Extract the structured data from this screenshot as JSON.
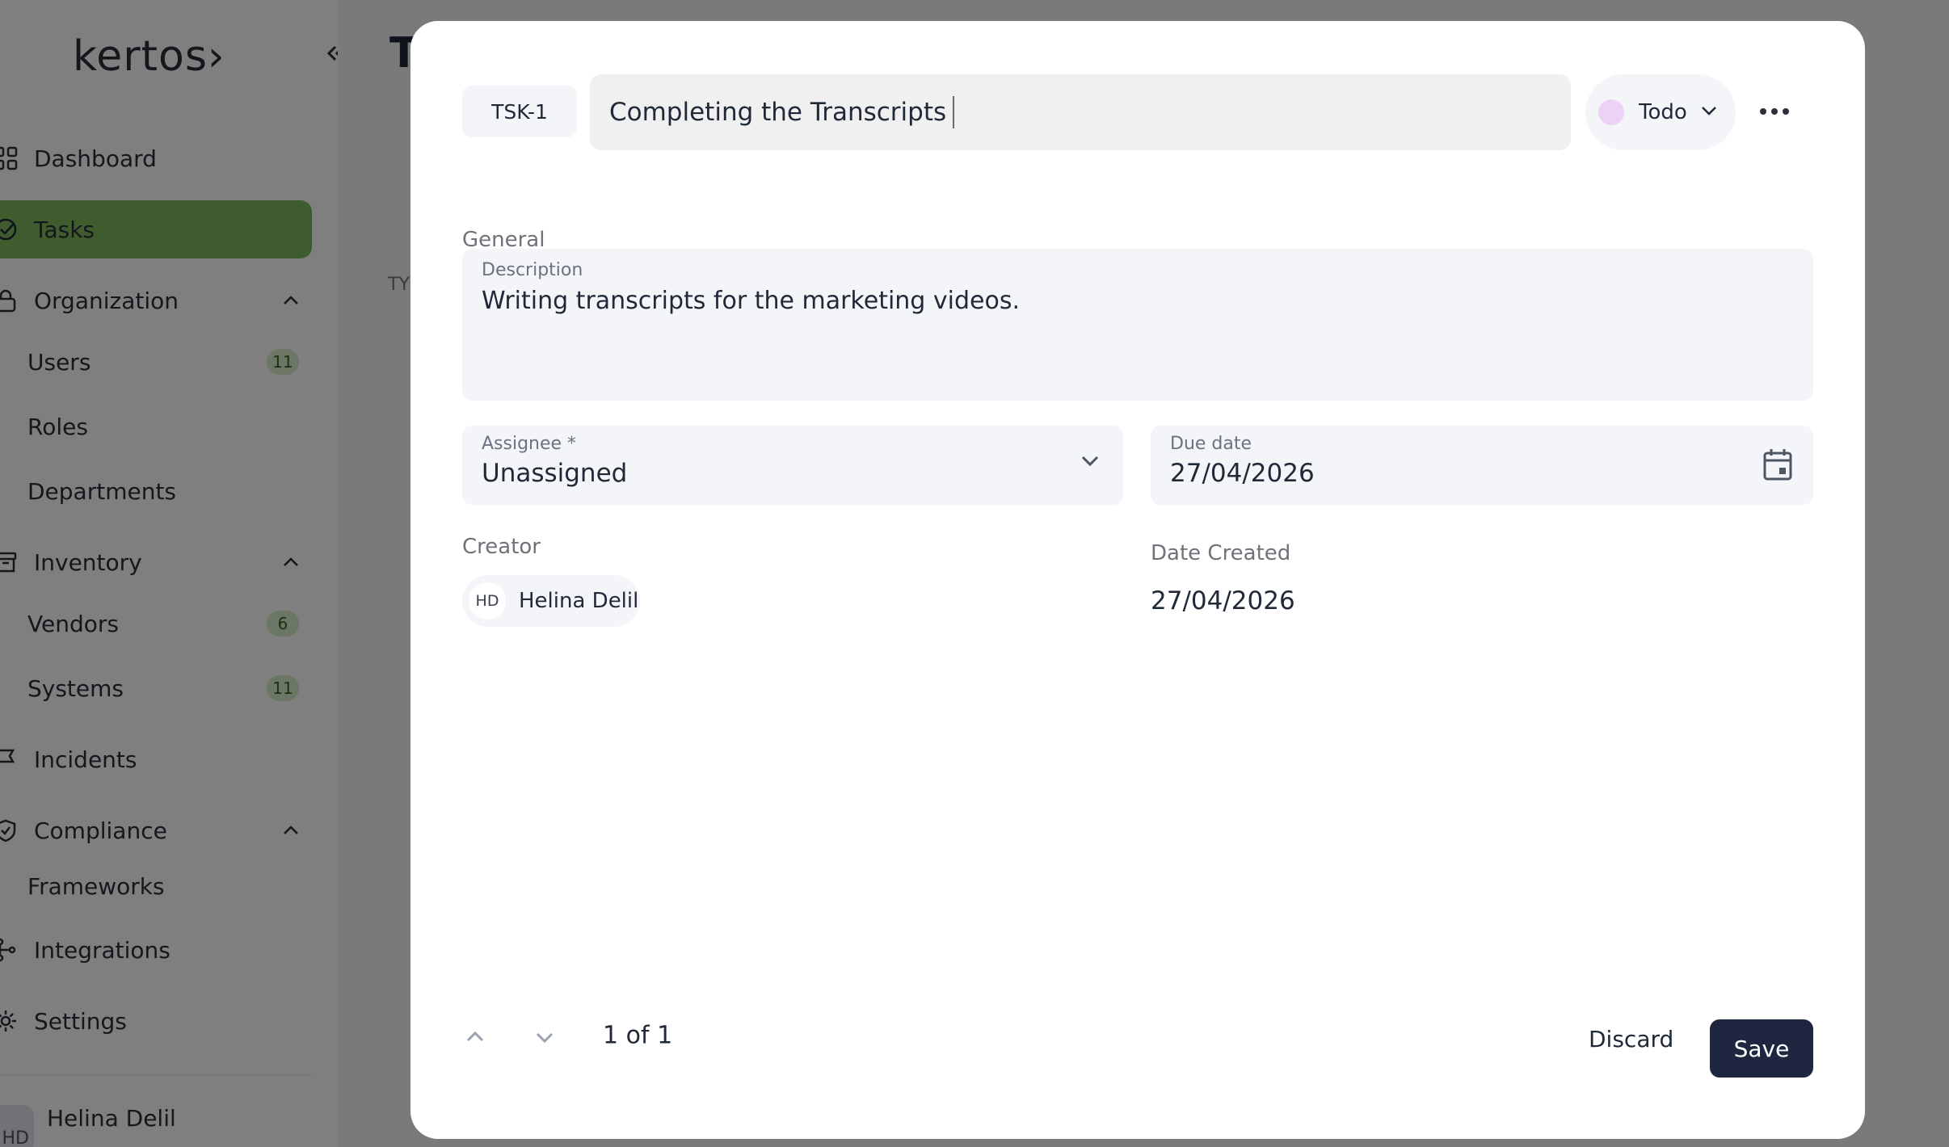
{
  "app": {
    "logo": "kertos›",
    "page_title": "T",
    "column_label": "TY"
  },
  "sidebar": {
    "items": [
      {
        "label": "Dashboard",
        "icon": "grid-icon"
      },
      {
        "label": "Tasks",
        "icon": "check-circle-icon",
        "active": true
      },
      {
        "label": "Organization",
        "icon": "lock-icon"
      },
      {
        "label": "Inventory",
        "icon": "archive-icon"
      },
      {
        "label": "Incidents",
        "icon": "flag-icon"
      },
      {
        "label": "Compliance",
        "icon": "shield-check-icon"
      },
      {
        "label": "Integrations",
        "icon": "network-icon"
      },
      {
        "label": "Settings",
        "icon": "gear-icon"
      }
    ],
    "organization_children": [
      {
        "label": "Users",
        "count": "11"
      },
      {
        "label": "Roles"
      },
      {
        "label": "Departments"
      }
    ],
    "inventory_children": [
      {
        "label": "Vendors",
        "count": "6"
      },
      {
        "label": "Systems",
        "count": "11"
      }
    ],
    "compliance_children": [
      {
        "label": "Frameworks"
      }
    ],
    "user": {
      "name": "Helina Delil",
      "initials": "HD"
    }
  },
  "modal": {
    "task_id": "TSK-1",
    "title_value": "Completing the Transcripts",
    "status": {
      "label": "Todo",
      "color": "#ecd3f6"
    },
    "section_general": "General",
    "description": {
      "label": "Description",
      "value": "Writing transcripts for the marketing videos."
    },
    "assignee": {
      "label": "Assignee *",
      "value": "Unassigned"
    },
    "due_date": {
      "label": "Due date",
      "value": "27/04/2026"
    },
    "creator": {
      "label": "Creator",
      "initials": "HD",
      "name": "Helina Delil"
    },
    "date_created": {
      "label": "Date Created",
      "value": "27/04/2026"
    },
    "pager": "1 of 1",
    "discard_label": "Discard",
    "save_label": "Save"
  },
  "colors": {
    "accent": "#7cb85c",
    "primary_button": "#1f2640"
  }
}
